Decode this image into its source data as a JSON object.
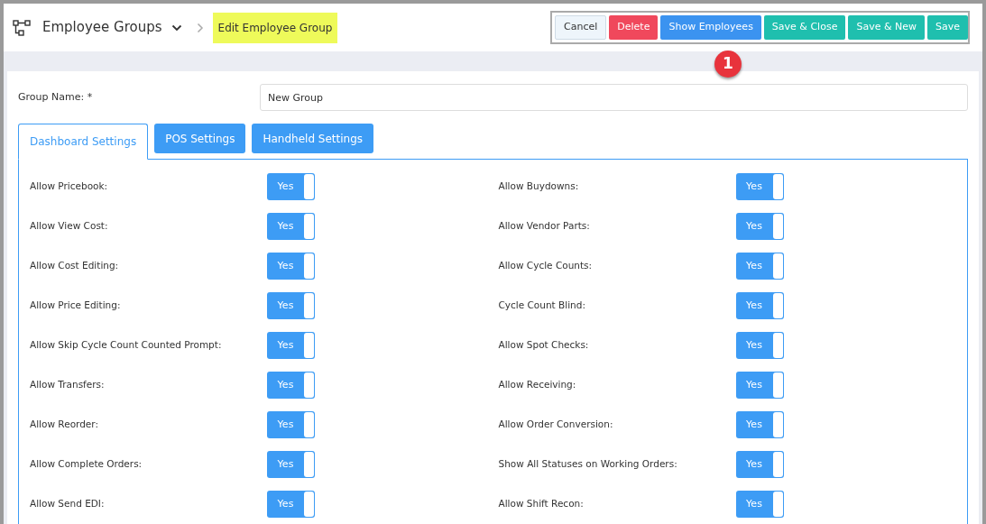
{
  "header": {
    "title": "Employee Groups",
    "current_page": "Edit Employee Group"
  },
  "actions": [
    {
      "label": "Cancel",
      "kind": "default"
    },
    {
      "label": "Delete",
      "kind": "danger"
    },
    {
      "label": "Show Employees",
      "kind": "primary"
    },
    {
      "label": "Save & Close",
      "kind": "success"
    },
    {
      "label": "Save & New",
      "kind": "success"
    },
    {
      "label": "Save",
      "kind": "success"
    }
  ],
  "callout": "1",
  "group_name": {
    "label": "Group Name: *",
    "value": "New Group"
  },
  "tabs": [
    {
      "label": "Dashboard Settings",
      "selected": true
    },
    {
      "label": "POS Settings",
      "selected": false
    },
    {
      "label": "Handheld Settings",
      "selected": false
    }
  ],
  "settings": [
    {
      "label": "Allow Pricebook:",
      "value": "Yes",
      "on": true
    },
    {
      "label": "Allow Buydowns:",
      "value": "Yes",
      "on": true
    },
    {
      "label": "Allow View Cost:",
      "value": "Yes",
      "on": true
    },
    {
      "label": "Allow Vendor Parts:",
      "value": "Yes",
      "on": true
    },
    {
      "label": "Allow Cost Editing:",
      "value": "Yes",
      "on": true
    },
    {
      "label": "Allow Cycle Counts:",
      "value": "Yes",
      "on": true
    },
    {
      "label": "Allow Price Editing:",
      "value": "Yes",
      "on": true
    },
    {
      "label": "Cycle Count Blind:",
      "value": "Yes",
      "on": true
    },
    {
      "label": "Allow Skip Cycle Count Counted Prompt:",
      "value": "Yes",
      "on": true
    },
    {
      "label": "Allow Spot Checks:",
      "value": "Yes",
      "on": true
    },
    {
      "label": "Allow Transfers:",
      "value": "Yes",
      "on": true
    },
    {
      "label": "Allow Receiving:",
      "value": "Yes",
      "on": true
    },
    {
      "label": "Allow Reorder:",
      "value": "Yes",
      "on": true
    },
    {
      "label": "Allow Order Conversion:",
      "value": "Yes",
      "on": true
    },
    {
      "label": "Allow Complete Orders:",
      "value": "Yes",
      "on": true
    },
    {
      "label": "Show All Statuses on Working Orders:",
      "value": "Yes",
      "on": true
    },
    {
      "label": "Allow Send EDI:",
      "value": "Yes",
      "on": true
    },
    {
      "label": "Allow Shift Recon:",
      "value": "Yes",
      "on": true
    }
  ]
}
